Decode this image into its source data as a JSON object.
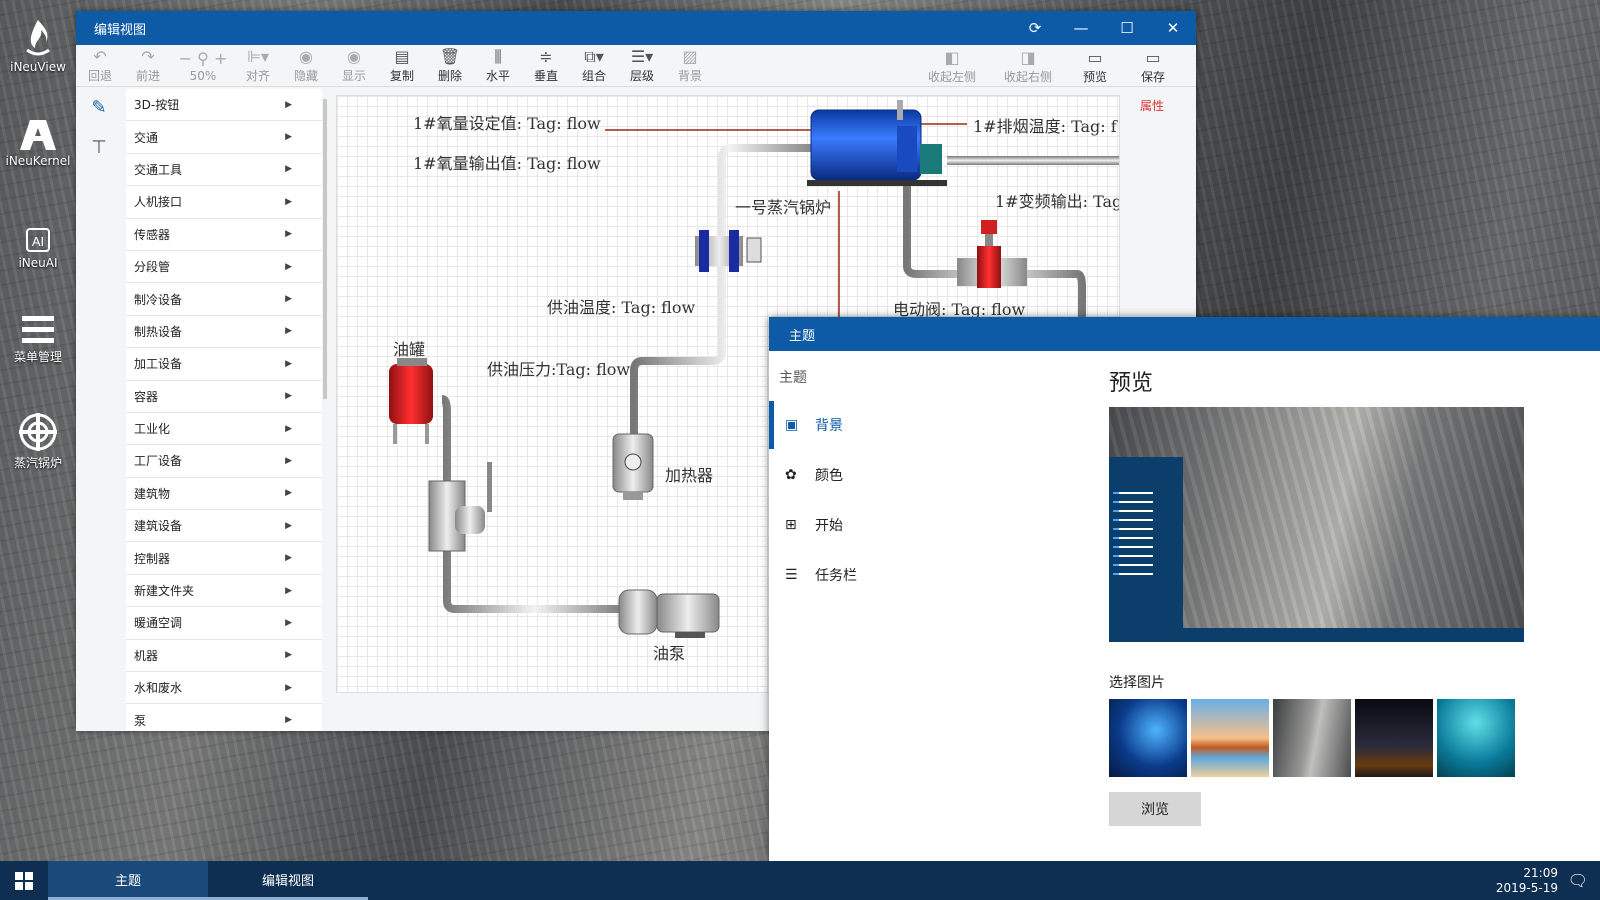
{
  "desktop": {
    "icons": [
      {
        "label": "iNeuView"
      },
      {
        "label": "iNeuKernel"
      },
      {
        "label": "iNeuAI"
      },
      {
        "label": "菜单管理"
      },
      {
        "label": "蒸汽锅炉"
      }
    ]
  },
  "editor": {
    "title": "编辑视图",
    "toolbar": {
      "undo": "回退",
      "redo": "前进",
      "zoom": "50%",
      "align": "对齐",
      "hide": "隐藏",
      "show": "显示",
      "copy": "复制",
      "delete": "删除",
      "horizontal": "水平",
      "vertical": "垂直",
      "group": "组合",
      "layer": "层级",
      "background": "背景",
      "collapse_left": "收起左侧",
      "collapse_right": "收起右侧",
      "preview": "预览",
      "save": "保存"
    },
    "properties_label": "属性",
    "categories": [
      "3D-按钮",
      "交通",
      "交通工具",
      "人机接口",
      "传感器",
      "分段管",
      "制冷设备",
      "制热设备",
      "加工设备",
      "容器",
      "工业化",
      "工厂设备",
      "建筑物",
      "建筑设备",
      "控制器",
      "新建文件夹",
      "暖通空调",
      "机器",
      "水和废水",
      "泵"
    ],
    "canvas": {
      "o2_setpoint": "1#氧量设定值: Tag:  flow",
      "o2_output": "1#氧量输出值: Tag:  flow",
      "exhaust_temp": "1#排烟温度: Tag:  f",
      "boiler_label": "一号蒸汽锅炉",
      "vfd_output": "1#变频输出: Tag",
      "oil_temp": "供油温度: Tag:  flow",
      "motor_valve": "电动阀: Tag:  flow",
      "oil_tank": "油罐",
      "oil_pressure": "供油压力:Tag:  flow",
      "heater": "加热器",
      "oil_pump": "油泵"
    }
  },
  "theme": {
    "title": "主题",
    "nav_heading": "主题",
    "nav": [
      {
        "label": "背景",
        "icon": "image-icon"
      },
      {
        "label": "颜色",
        "icon": "palette-icon"
      },
      {
        "label": "开始",
        "icon": "windows-icon"
      },
      {
        "label": "任务栏",
        "icon": "taskbar-icon"
      }
    ],
    "preview_heading": "预览",
    "select_heading": "选择图片",
    "browse": "浏览"
  },
  "taskbar": {
    "tasks": [
      "主题",
      "编辑视图"
    ],
    "time": "21:09",
    "date": "2019-5-19"
  }
}
